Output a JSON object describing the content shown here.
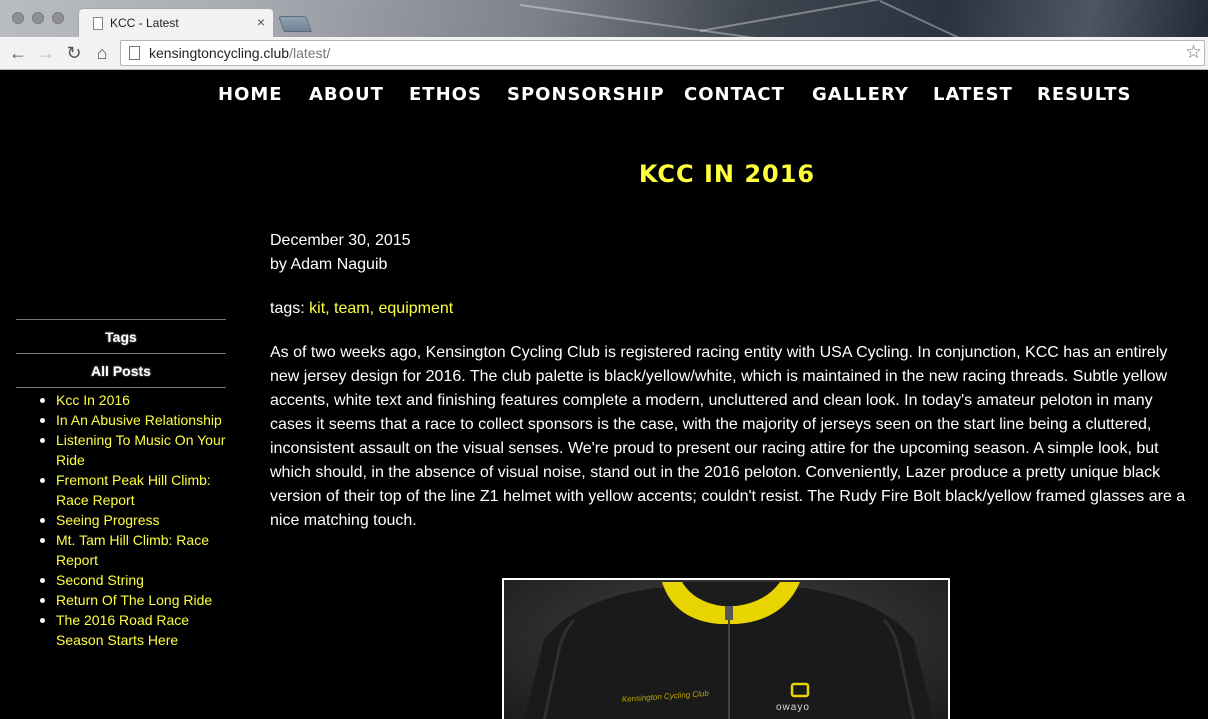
{
  "browser": {
    "tab_title": "KCC - Latest",
    "tab_close": "×",
    "url_domain": "kensingtoncycling.club",
    "url_path": "/latest/",
    "back_glyph": "←",
    "forward_glyph": "→",
    "reload_glyph": "↻",
    "home_glyph": "⌂",
    "star_glyph": "☆"
  },
  "nav": {
    "items": [
      "HOME",
      "ABOUT",
      "ETHOS",
      "SPONSORSHIP",
      "CONTACT",
      "GALLERY",
      "LATEST",
      "RESULTS"
    ]
  },
  "sidebar": {
    "tags_heading": "Tags",
    "all_posts_heading": "All Posts",
    "posts": [
      "Kcc In 2016",
      "In An Abusive Relationship",
      "Listening To Music On Your Ride",
      "Fremont Peak Hill Climb: Race Report",
      "Seeing Progress",
      "Mt. Tam Hill Climb: Race Report",
      "Second String",
      "Return Of The Long Ride",
      "The 2016 Road Race Season Starts Here"
    ]
  },
  "post": {
    "title": "KCC IN 2016",
    "date": "December 30, 2015",
    "author": "by Adam Naguib",
    "tags_label": "tags:",
    "tags": [
      "kit",
      "team",
      "equipment"
    ],
    "body": "As of two weeks ago, Kensington Cycling Club is registered racing entity with USA Cycling. In conjunction, KCC has an entirely new jersey design for 2016. The club palette is black/yellow/white, which is maintained in the new racing threads. Subtle yellow accents, white text and finishing features complete a modern, uncluttered and clean look. In today's amateur peloton in many cases it seems that a race to collect sponsors is the case, with the majority of jerseys seen on the start line being a cluttered, inconsistent assault on the visual senses. We're proud to present our racing attire for the upcoming season. A simple look, but which should, in the absence of visual noise, stand out in the 2016 peloton. Conveniently, Lazer produce a pretty unique black version of their top of the line Z1 helmet with yellow accents; couldn't resist. The Rudy Fire Bolt black/yellow framed glasses are a nice matching touch.",
    "image": {
      "chest_text": "Kensington Cycling Club",
      "brand_text": "owayo",
      "colors": {
        "jersey": "#1a1a1a",
        "collar": "#e8d400",
        "background": "#3a3a3a"
      }
    }
  },
  "colors": {
    "accent": "#ffff42",
    "background": "#000000",
    "text": "#ffffff"
  }
}
